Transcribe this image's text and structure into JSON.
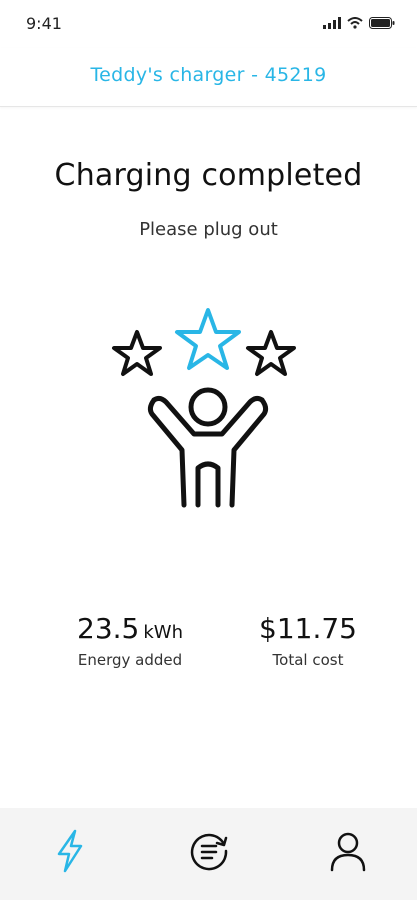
{
  "status_bar": {
    "time": "9:41",
    "icons": [
      "signal-icon",
      "wifi-icon",
      "battery-icon"
    ]
  },
  "header": {
    "title": "Teddy's charger - 45219"
  },
  "main": {
    "title": "Charging completed",
    "subtitle": "Please plug out",
    "illustration_icon": "celebrating-person-with-stars-icon",
    "stats": {
      "energy": {
        "value": "23.5",
        "unit": "kWh",
        "label": "Energy added"
      },
      "cost": {
        "value": "$11.75",
        "label": "Total cost"
      }
    }
  },
  "bottom_nav": {
    "items": [
      {
        "icon": "lightning-icon",
        "active": true
      },
      {
        "icon": "history-list-icon",
        "active": false
      },
      {
        "icon": "user-icon",
        "active": false
      }
    ]
  },
  "colors": {
    "accent": "#29b6e6",
    "text": "#111111",
    "nav_background": "#f4f4f4"
  }
}
